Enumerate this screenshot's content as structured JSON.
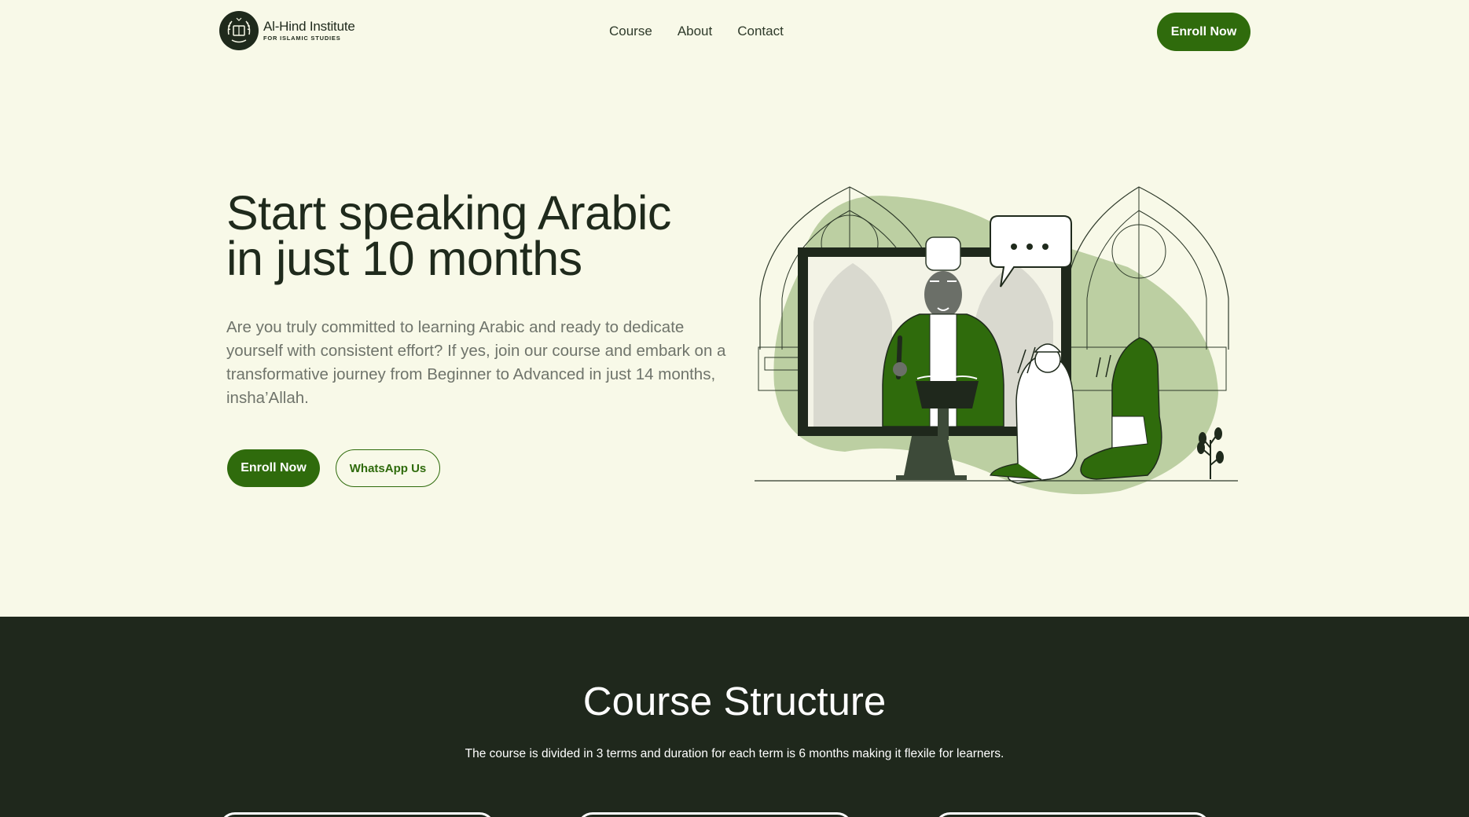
{
  "brand": {
    "name": "Al-Hind Institute",
    "tagline": "FOR ISLAMIC STUDIES",
    "primary_color": "#2f6b0c",
    "dark_color": "#1f281c",
    "background": "#f8f9e8"
  },
  "nav": {
    "items": [
      "Course",
      "About",
      "Contact"
    ],
    "cta_label": "Enroll Now"
  },
  "hero": {
    "title_line1": "Start speaking Arabic",
    "title_line2": "in just 10 months",
    "description": "Are you truly committed to learning Arabic and ready to dedicate yourself with consistent effort? If yes, join our course and embark on a transformative journey from Beginner to Advanced in just 14 months, insha’Allah.",
    "primary_button": "Enroll Now",
    "secondary_button": "WhatsApp Us",
    "illustration": "online-islamic-class-illustration"
  },
  "course_structure": {
    "title": "Course Structure",
    "subtitle": "The course is divided in 3 terms and duration for each term is 6 months making it flexile for learners."
  }
}
